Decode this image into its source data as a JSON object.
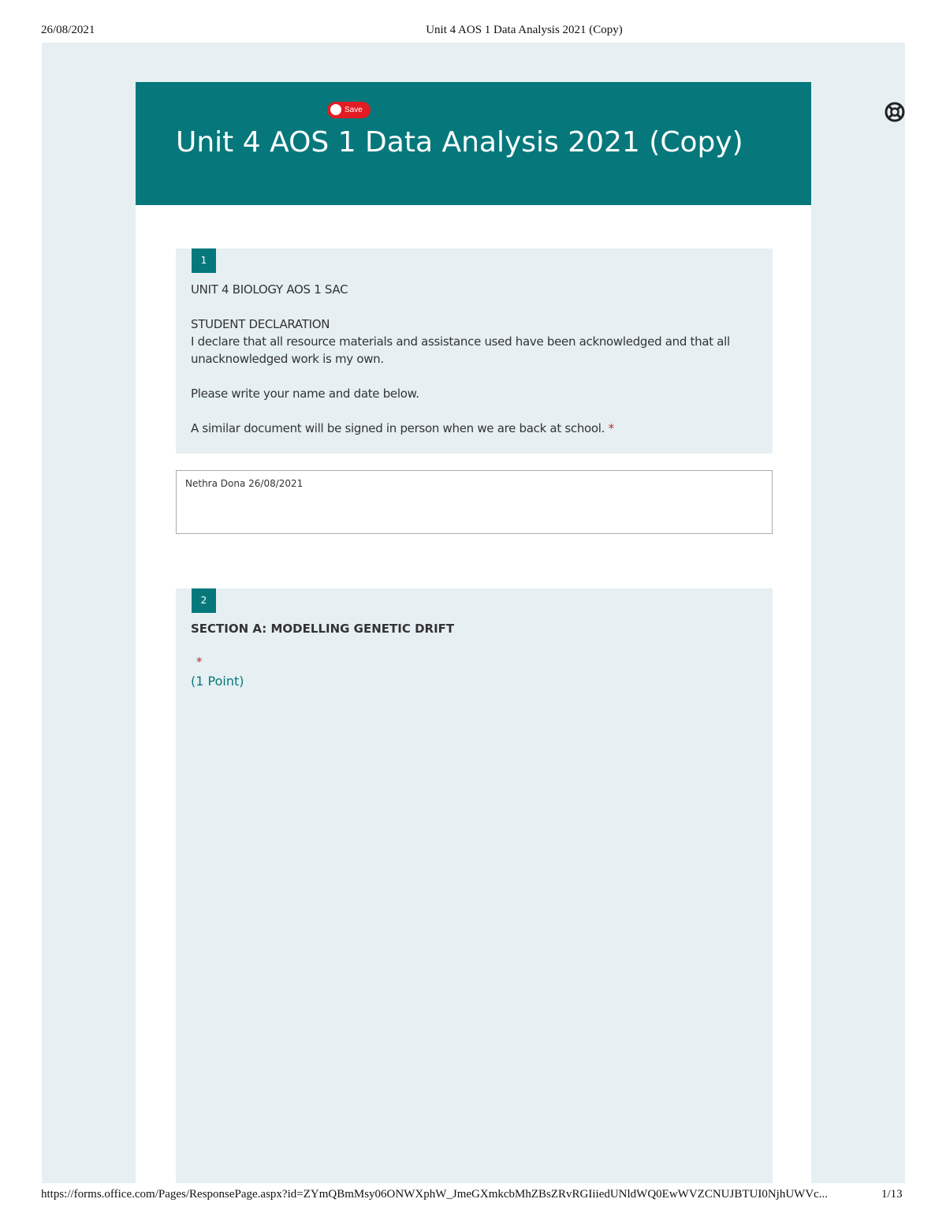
{
  "print_header": {
    "date": "26/08/2021",
    "title": "Unit 4 AOS 1 Data Analysis 2021 (Copy)"
  },
  "print_footer": {
    "url": "https://forms.office.com/Pages/ResponsePage.aspx?id=ZYmQBmMsy06ONWXphW_JmeGXmkcbMhZBsZRvRGIiiedUNldWQ0EwWVZCNUJBTUI0NjhUWVc...",
    "page": "1/13"
  },
  "save_badge": {
    "label": "Save"
  },
  "form": {
    "title": "Unit 4 AOS 1 Data Analysis 2021 (Copy)"
  },
  "questions": [
    {
      "number": "1",
      "lines": [
        "UNIT 4 BIOLOGY AOS 1 SAC",
        "STUDENT DECLARATION",
        "I declare that all resource materials and assistance used have been acknowledged and that all unacknowledged work is my own.",
        "Please write your name and date below.",
        "A similar document will be signed in person when we are back at school."
      ],
      "required_mark": "*",
      "answer": "Nethra Dona 26/08/2021"
    },
    {
      "number": "2",
      "title": "SECTION A: MODELLING GENETIC DRIFT",
      "required_mark": "*",
      "points": "(1 Point)"
    }
  ],
  "icons": {
    "help": "help-lifebuoy-icon",
    "save": "record-dot-icon"
  },
  "colors": {
    "accent": "#06787c",
    "page_background": "#e6f0f3",
    "required": "#c4262e",
    "save_badge": "#e31b23"
  }
}
